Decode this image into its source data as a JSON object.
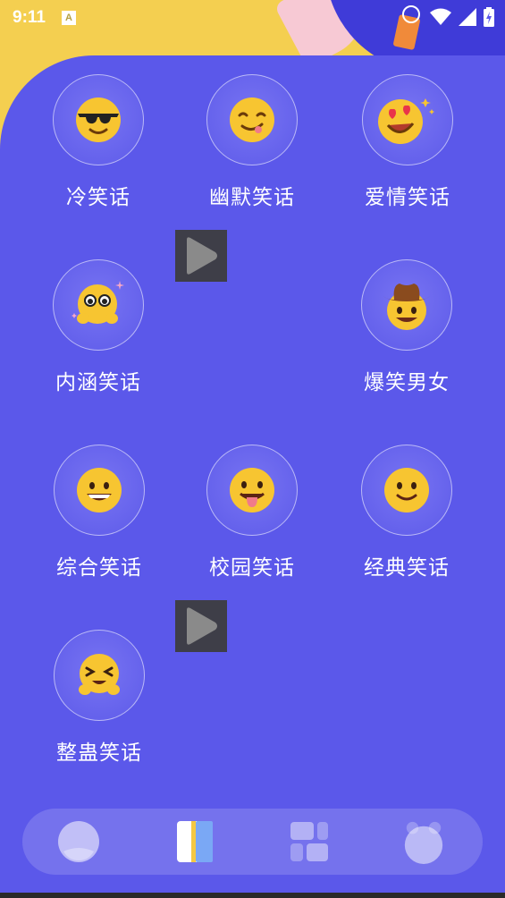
{
  "status_bar": {
    "time": "9:11",
    "notification_badge": "A",
    "icons": [
      "wifi-icon",
      "signal-icon",
      "battery-charging-icon"
    ]
  },
  "categories": [
    {
      "label": "冷笑话",
      "icon": "sunglasses-emoji-icon"
    },
    {
      "label": "幽默笑话",
      "icon": "yum-emoji-icon"
    },
    {
      "label": "爱情笑话",
      "icon": "heart-eyes-emoji-icon"
    },
    {
      "label": "内涵笑话",
      "icon": "sparkle-emoji-icon"
    },
    {
      "label": "爆笑男女",
      "icon": "cowboy-emoji-icon"
    },
    {
      "label": "综合笑话",
      "icon": "grin-emoji-icon"
    },
    {
      "label": "校园笑话",
      "icon": "tongue-emoji-icon"
    },
    {
      "label": "经典笑话",
      "icon": "smile-emoji-icon"
    },
    {
      "label": "整蛊笑话",
      "icon": "laugh-emoji-icon"
    }
  ],
  "ad_placeholders": [
    "video-play-icon",
    "video-play-icon"
  ],
  "bottom_nav": [
    "home-tab-icon",
    "jokes-tab-icon",
    "grid-tab-icon",
    "profile-tab-icon"
  ],
  "colors": {
    "background": "#5b58ea",
    "top_accent": "#f4cf50",
    "emoji_yellow": "#f7c531"
  }
}
